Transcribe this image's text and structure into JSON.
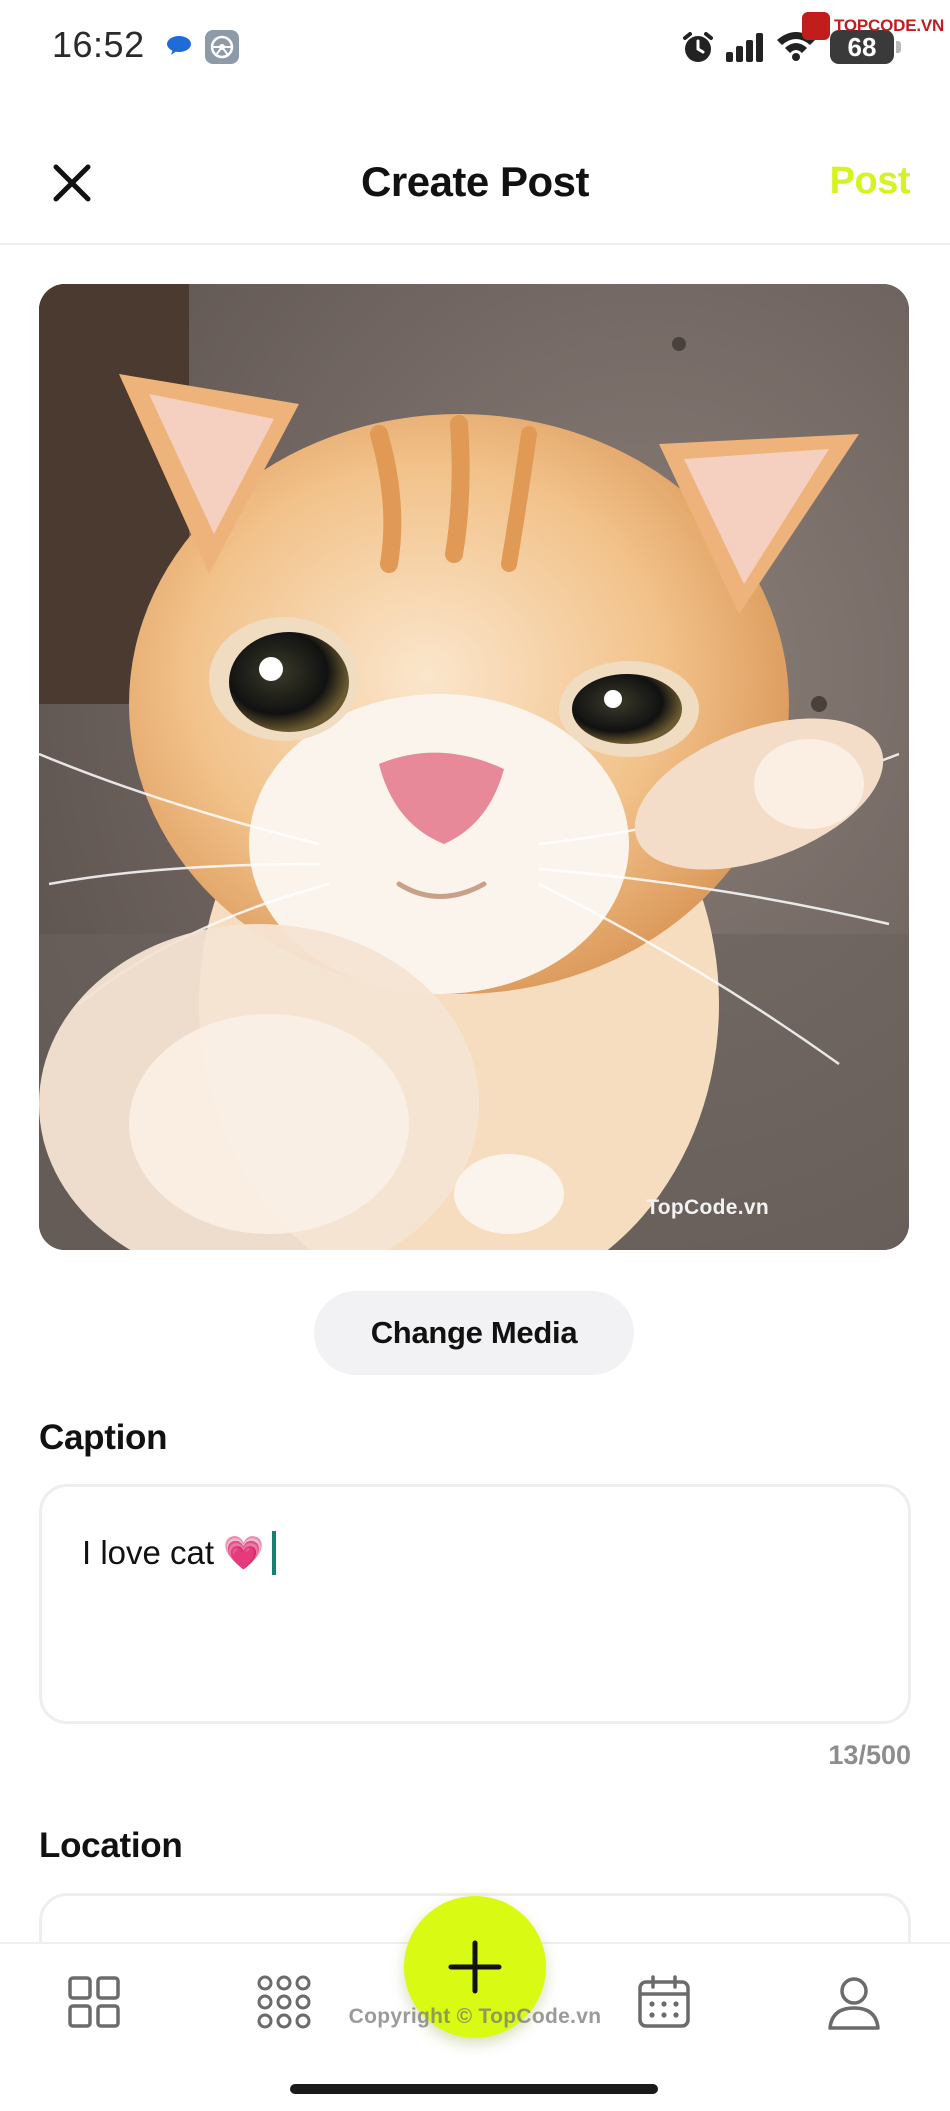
{
  "status_bar": {
    "time": "16:52",
    "battery": "68",
    "watermark": "TOPCODE.VN",
    "icons": [
      "chat-bubble-icon",
      "app-icon",
      "alarm-icon",
      "cellular-signal-icon",
      "wifi-icon",
      "battery-icon"
    ]
  },
  "header": {
    "title": "Create Post",
    "post_label": "Post",
    "close_icon": "close-icon",
    "accent_color": "#d6f221"
  },
  "media": {
    "watermark": "TopCode.vn",
    "change_label": "Change Media"
  },
  "caption": {
    "label": "Caption",
    "value": "I love cat 💗",
    "count": "13/500"
  },
  "location": {
    "label": "Location",
    "value": ""
  },
  "bottom_nav": {
    "items": [
      {
        "icon": "grid-icon"
      },
      {
        "icon": "dots-grid-icon"
      },
      {
        "icon": "plus-icon"
      },
      {
        "icon": "calendar-icon"
      },
      {
        "icon": "profile-icon"
      }
    ],
    "fab_color": "#d8fa13",
    "watermark": "Copyright © TopCode.vn"
  }
}
